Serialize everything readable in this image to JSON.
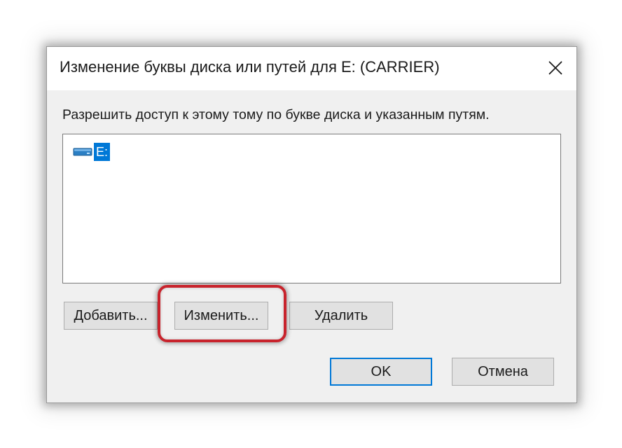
{
  "dialog": {
    "title": "Изменение буквы диска или путей для E: (CARRIER)",
    "close_icon": "close-icon",
    "prompt": "Разрешить доступ к этому тому по букве диска и указанным путям.",
    "list": {
      "items": [
        {
          "label": "E:",
          "icon": "drive-icon",
          "selected": true
        }
      ]
    },
    "buttons": {
      "add": "Добавить...",
      "change": "Изменить...",
      "remove": "Удалить",
      "ok": "OK",
      "cancel": "Отмена"
    },
    "colors": {
      "selection": "#0078d7",
      "highlight_ring": "#c8232c",
      "dialog_bg": "#f0f0f0",
      "button_bg": "#e1e1e1"
    }
  }
}
